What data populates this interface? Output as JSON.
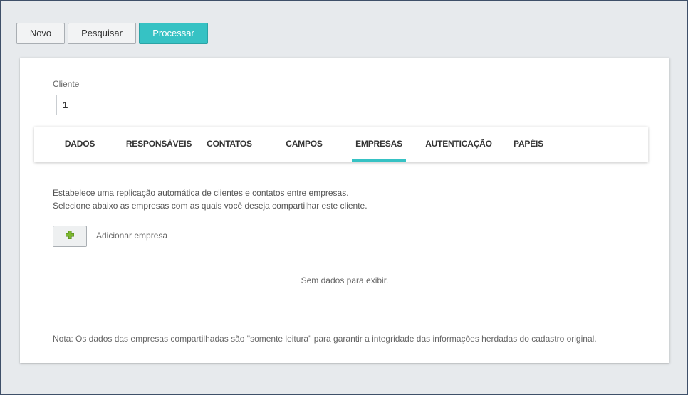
{
  "toolbar": {
    "new_label": "Novo",
    "search_label": "Pesquisar",
    "process_label": "Processar"
  },
  "form": {
    "client_label": "Cliente",
    "client_value": "1"
  },
  "tabs": [
    {
      "label": "DADOS"
    },
    {
      "label": "RESPONSÁVEIS"
    },
    {
      "label": "CONTATOS"
    },
    {
      "label": "CAMPOS"
    },
    {
      "label": "EMPRESAS",
      "active": true
    },
    {
      "label": "AUTENTICAÇÃO"
    },
    {
      "label": "PAPÉIS"
    }
  ],
  "empresas": {
    "description_line1": "Estabelece uma replicação automática de clientes e contatos entre empresas.",
    "description_line2": "Selecione abaixo as empresas com as quais você deseja compartilhar este cliente.",
    "add_icon": "plus-icon",
    "add_label": "Adicionar empresa",
    "empty_message": "Sem dados para exibir.",
    "note": "Nota: Os dados das empresas compartilhadas são \"somente leitura\" para garantir a integridade das informações herdadas do cadastro original."
  },
  "colors": {
    "accent": "#36c2c4",
    "plus_icon": "#7cb82f"
  }
}
